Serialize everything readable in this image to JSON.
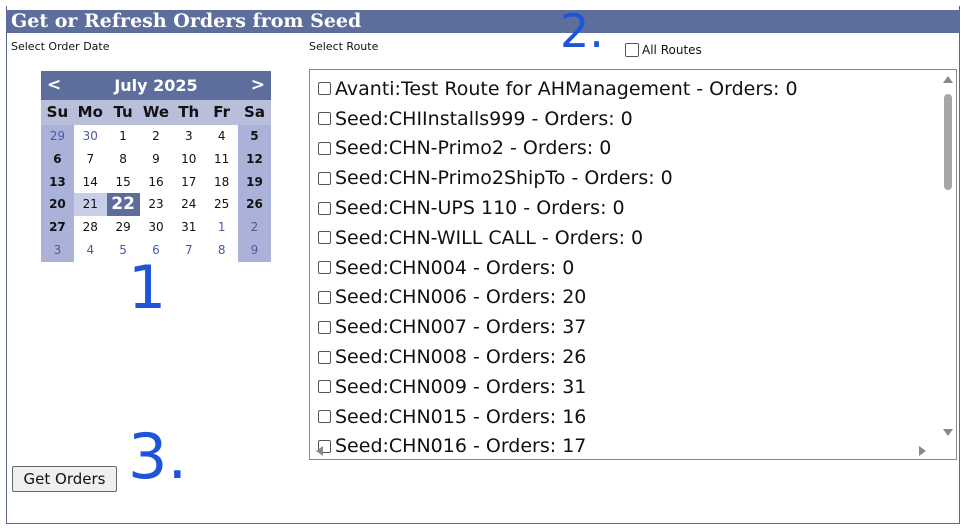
{
  "header": {
    "title": "Get or Refresh Orders from Seed"
  },
  "labels": {
    "select_order_date": "Select Order Date",
    "select_route": "Select Route",
    "all_routes": "All Routes"
  },
  "calendar": {
    "prev": "<",
    "next": ">",
    "month": "July 2025",
    "days_of_week": [
      "Su",
      "Mo",
      "Tu",
      "We",
      "Th",
      "Fr",
      "Sa"
    ],
    "weeks": [
      [
        "29",
        "30",
        "1",
        "2",
        "3",
        "4",
        "5"
      ],
      [
        "6",
        "7",
        "8",
        "9",
        "10",
        "11",
        "12"
      ],
      [
        "13",
        "14",
        "15",
        "16",
        "17",
        "18",
        "19"
      ],
      [
        "20",
        "21",
        "22",
        "23",
        "24",
        "25",
        "26"
      ],
      [
        "27",
        "28",
        "29",
        "30",
        "31",
        "1",
        "2"
      ],
      [
        "3",
        "4",
        "5",
        "6",
        "7",
        "8",
        "9"
      ]
    ],
    "selected": "22"
  },
  "routes": [
    "Avanti:Test Route for AHManagement - Orders: 0",
    "Seed:CHIInstalls999 - Orders: 0",
    "Seed:CHN-Primo2 - Orders: 0",
    "Seed:CHN-Primo2ShipTo - Orders: 0",
    "Seed:CHN-UPS 110 - Orders: 0",
    "Seed:CHN-WILL CALL - Orders: 0",
    "Seed:CHN004 - Orders: 0",
    "Seed:CHN006 - Orders: 20",
    "Seed:CHN007 - Orders: 37",
    "Seed:CHN008 - Orders: 26",
    "Seed:CHN009 - Orders: 31",
    "Seed:CHN015 - Orders: 16",
    "Seed:CHN016 - Orders: 17"
  ],
  "button": {
    "get_orders": "Get Orders"
  },
  "annotations": [
    "1",
    "2.",
    "3."
  ],
  "colors": {
    "header_bg": "#5e6e9c",
    "annotation": "#1e54d6"
  }
}
